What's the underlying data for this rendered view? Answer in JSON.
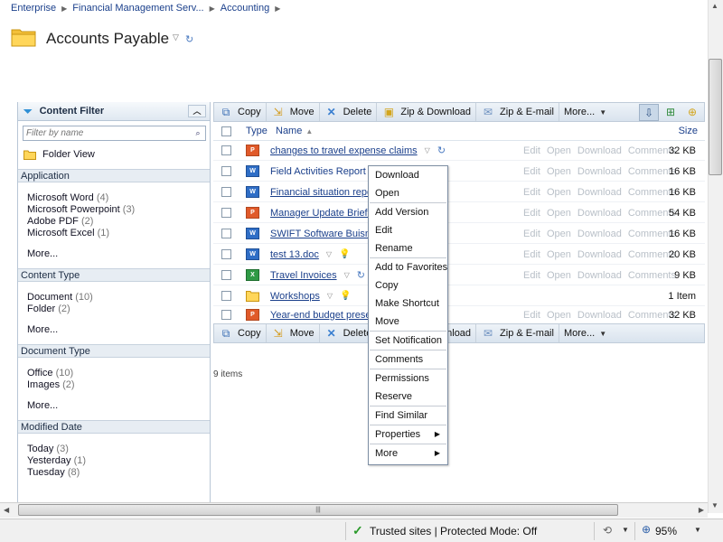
{
  "breadcrumb": [
    "Enterprise",
    "Financial Management Serv...",
    "Accounting"
  ],
  "title": "Accounts Payable",
  "content_filter": {
    "title": "Content Filter",
    "search_placeholder": "Filter by name",
    "folder_view": "Folder View",
    "sections": [
      {
        "name": "Application",
        "items": [
          {
            "label": "Microsoft Word",
            "count": "(4)"
          },
          {
            "label": "Microsoft Powerpoint",
            "count": "(3)"
          },
          {
            "label": "Adobe PDF",
            "count": "(2)"
          },
          {
            "label": "Microsoft Excel",
            "count": "(1)"
          }
        ],
        "more": "More..."
      },
      {
        "name": "Content Type",
        "items": [
          {
            "label": "Document",
            "count": "(10)"
          },
          {
            "label": "Folder",
            "count": "(2)"
          }
        ],
        "more": "More..."
      },
      {
        "name": "Document Type",
        "items": [
          {
            "label": "Office",
            "count": "(10)"
          },
          {
            "label": "Images",
            "count": "(2)"
          }
        ],
        "more": "More..."
      },
      {
        "name": "Modified Date",
        "items": [
          {
            "label": "Today",
            "count": "(3)"
          },
          {
            "label": "Yesterday",
            "count": "(1)"
          },
          {
            "label": "Tuesday",
            "count": "(8)"
          }
        ],
        "more": ""
      }
    ]
  },
  "toolbar_top": {
    "copy": "Copy",
    "move": "Move",
    "delete": "Delete",
    "zip_download": "Zip & Download",
    "zip_email": "Zip & E-mail",
    "more": "More..."
  },
  "toolbar_bottom": {
    "copy": "Copy",
    "move": "Move",
    "delete": "Delete",
    "zip_download": "Zip & Download",
    "zip_email": "Zip & E-mail",
    "more": "More..."
  },
  "table": {
    "col_type": "Type",
    "col_name": "Name",
    "col_size": "Size",
    "rows": [
      {
        "name": "changes to travel expense claims",
        "icon": "ppt",
        "size": "32 KB",
        "has_actions": true
      },
      {
        "name": "Field Activities Report",
        "icon": "word",
        "size": "16 KB",
        "has_actions": true
      },
      {
        "name": "Financial situation repo",
        "icon": "word",
        "size": "16 KB",
        "has_actions": true
      },
      {
        "name": "Manager Update Briefin",
        "icon": "ppt",
        "size": "54 KB",
        "has_actions": true
      },
      {
        "name": "SWIFT Software Buisne",
        "icon": "word",
        "size": "16 KB",
        "has_actions": true
      },
      {
        "name": "test 13.doc",
        "icon": "word",
        "size": "20 KB",
        "has_actions": true
      },
      {
        "name": "Travel Invoices",
        "icon": "excel",
        "size": "9 KB",
        "has_actions": true
      },
      {
        "name": "Workshops",
        "icon": "folder",
        "size": "1 Item",
        "has_actions": false
      },
      {
        "name": "Year-end budget prese",
        "icon": "ppt",
        "size": "32 KB",
        "has_actions": true
      }
    ],
    "actions": [
      "Edit",
      "Open",
      "Download",
      "Comments"
    ]
  },
  "item_count": "9 items",
  "context_menu": [
    [
      "Download",
      "Open"
    ],
    [
      "Add Version",
      "Edit",
      "Rename"
    ],
    [
      "Add to Favorites",
      "Copy",
      "Make Shortcut",
      "Move"
    ],
    [
      "Set Notification"
    ],
    [
      "Comments"
    ],
    [
      "Permissions",
      "Reserve"
    ],
    [
      "Find Similar"
    ],
    [
      "Properties"
    ],
    [
      "More"
    ]
  ],
  "status": {
    "zone": "Trusted sites | Protected Mode: Off",
    "zoom": "95%"
  }
}
